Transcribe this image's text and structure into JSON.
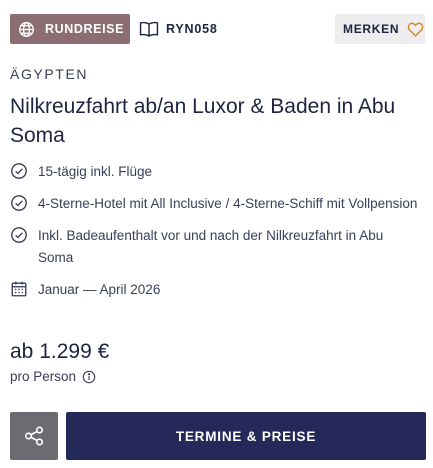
{
  "header": {
    "badge_icon": "globe-icon",
    "badge_label": "RUNDREISE",
    "code_icon": "book-icon",
    "code_label": "RYN058",
    "merken_label": "MERKEN",
    "merken_icon": "heart-outline-icon"
  },
  "trip": {
    "country": "ÄGYPTEN",
    "title": "Nilkreuzfahrt ab/an Luxor & Baden in Abu Soma"
  },
  "features": [
    {
      "icon": "check-circle-icon",
      "text": "15-tägig inkl. Flüge"
    },
    {
      "icon": "check-circle-icon",
      "text": "4-Sterne-Hotel mit All Inclusive / 4-Sterne-Schiff mit Vollpension"
    },
    {
      "icon": "check-circle-icon",
      "text": "Inkl. Badeaufenthalt vor und nach der Nilkreuzfahrt in Abu Soma"
    },
    {
      "icon": "calendar-icon",
      "text": "Januar — April 2026"
    }
  ],
  "pricing": {
    "price": "ab 1.299 €",
    "per_person": "pro Person"
  },
  "actions": {
    "share_icon": "share-icon",
    "cta_label": "TERMINE & PREISE"
  },
  "colors": {
    "badge_bg": "#8b6d72",
    "navy": "#25295a",
    "heart": "#d9822b",
    "share_bg": "#6d6a72"
  }
}
